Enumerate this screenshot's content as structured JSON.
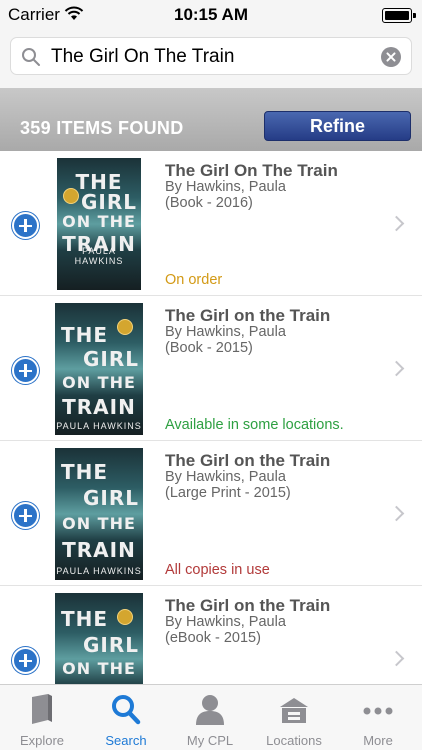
{
  "status_bar": {
    "carrier": "Carrier",
    "time": "10:15 AM"
  },
  "search": {
    "query": "The Girl On The Train"
  },
  "results_header": {
    "count_label": "359 ITEMS FOUND",
    "refine_label": "Refine"
  },
  "results": [
    {
      "title": "The Girl On The Train",
      "author": "By Hawkins, Paula",
      "format": "(Book - 2016)",
      "status": "On order",
      "status_color": "#d39a16",
      "cover": {
        "line1": "THE",
        "line2": "GIRL",
        "line3": "ON THE",
        "line4": "TRAIN",
        "author": "PAULA HAWKINS"
      }
    },
    {
      "title": "The Girl on the Train",
      "author": "By Hawkins, Paula",
      "format": "(Book - 2015)",
      "status": "Available in some locations.",
      "status_color": "#2ea042",
      "cover": {
        "line1": "THE",
        "line2": "GIRL",
        "line3": "ON THE",
        "line4": "TRAIN",
        "author": "PAULA HAWKINS"
      }
    },
    {
      "title": "The Girl on the Train",
      "author": "By Hawkins, Paula",
      "format": "(Large Print - 2015)",
      "status": "All copies in use",
      "status_color": "#b23a3a",
      "cover": {
        "line1": "THE",
        "line2": "GIRL",
        "line3": "ON THE",
        "line4": "TRAIN",
        "author": "PAULA HAWKINS"
      }
    },
    {
      "title": "The Girl on the Train",
      "author": "By Hawkins, Paula",
      "format": "(eBook - 2015)",
      "status": "",
      "status_color": "#333333",
      "cover": {
        "line1": "THE",
        "line2": "GIRL",
        "line3": "ON THE",
        "line4": "",
        "author": ""
      }
    }
  ],
  "tabs": [
    {
      "label": "Explore",
      "icon": "book-icon",
      "active": false
    },
    {
      "label": "Search",
      "icon": "search-icon",
      "active": true
    },
    {
      "label": "My CPL",
      "icon": "person-icon",
      "active": false
    },
    {
      "label": "Locations",
      "icon": "library-building-icon",
      "active": false
    },
    {
      "label": "More",
      "icon": "more-dots-icon",
      "active": false
    }
  ],
  "colors": {
    "accent": "#1e7ad6",
    "refine": "#2c4a96",
    "add_button": "#2c73c8"
  }
}
